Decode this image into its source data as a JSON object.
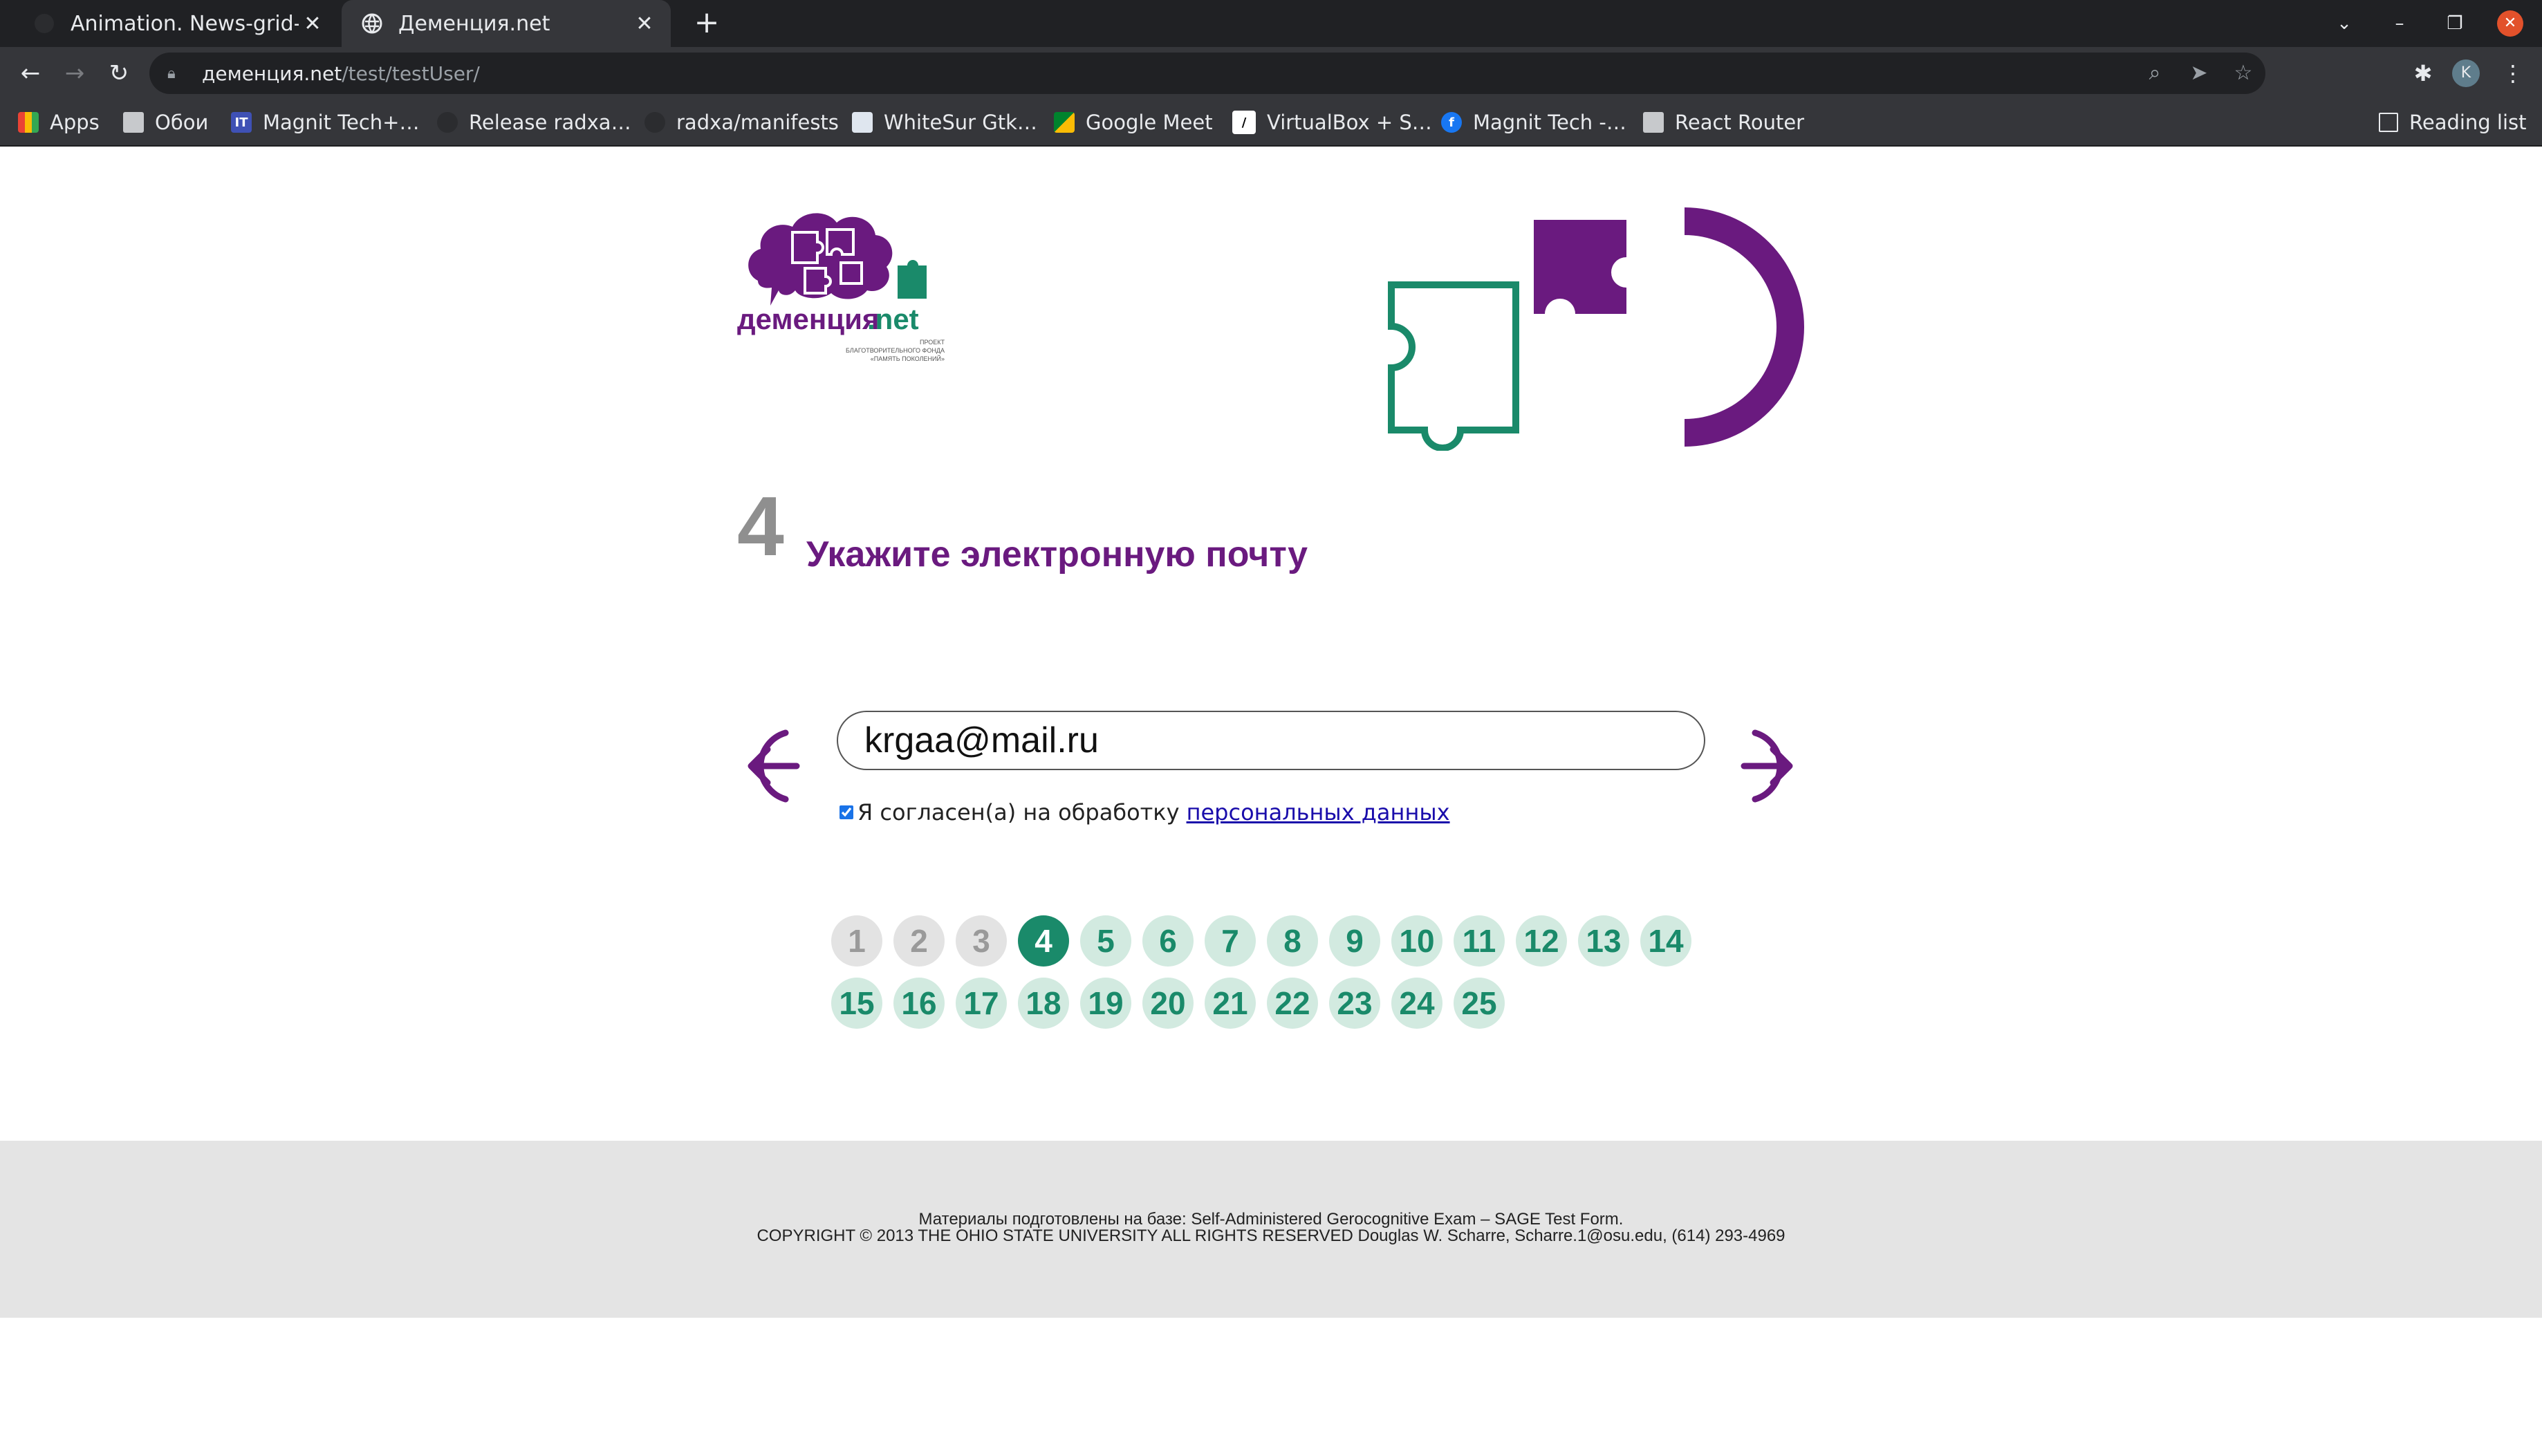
{
  "browser": {
    "tabs": [
      {
        "title": "Animation. News-grid-pag",
        "active": false
      },
      {
        "title": "Деменция.net",
        "active": true
      }
    ],
    "url_host": "деменция.net",
    "url_path": "/test/testUser/",
    "bookmarks": [
      {
        "label": "Apps",
        "icon": "apps-grid-icon"
      },
      {
        "label": "Обои",
        "icon": "folder-icon"
      },
      {
        "label": "Magnit Tech+…",
        "icon": "it-icon"
      },
      {
        "label": "Release radxa…",
        "icon": "github-icon"
      },
      {
        "label": "radxa/manifests",
        "icon": "github-icon"
      },
      {
        "label": "WhiteSur Gtk…",
        "icon": "site-icon"
      },
      {
        "label": "Google Meet",
        "icon": "meet-icon"
      },
      {
        "label": "VirtualBox + S…",
        "icon": "site-icon"
      },
      {
        "label": "Magnit Tech -…",
        "icon": "facebook-icon"
      },
      {
        "label": "React Router",
        "icon": "folder-icon"
      }
    ],
    "reading_list": "Reading list",
    "avatar_letter": "K"
  },
  "logo": {
    "brand": "деменция",
    "brand_suffix": ".net",
    "tagline_1": "ПРОЕКТ",
    "tagline_2": "БЛАГОТВОРИТЕЛЬНОГО ФОНДА",
    "tagline_3": "«ПАМЯТЬ ПОКОЛЕНИЙ»"
  },
  "question": {
    "number": "4",
    "title": "Укажите электронную почту"
  },
  "form": {
    "email_value": "krgaa@mail.ru",
    "consent_checked": true,
    "consent_text": "Я согласен(а) на обработку",
    "consent_link": "персональных данных"
  },
  "pager": {
    "current": 4,
    "pages": [
      "1",
      "2",
      "3",
      "4",
      "5",
      "6",
      "7",
      "8",
      "9",
      "10",
      "11",
      "12",
      "13",
      "14",
      "15",
      "16",
      "17",
      "18",
      "19",
      "20",
      "21",
      "22",
      "23",
      "24",
      "25"
    ]
  },
  "footer": {
    "line1": "Материалы подготовлены на базе: Self-Administered Gerocognitive Exam – SAGE Test Form.",
    "line2": "COPYRIGHT © 2013 THE OHIO STATE UNIVERSITY ALL RIGHTS RESERVED Douglas W. Scharre, Scharre.1@osu.edu, (614) 293-4969"
  },
  "colors": {
    "brand_purple": "#6a1a7f",
    "brand_green": "#1a8a6a",
    "page_done": "#e3e3e3",
    "page_todo": "#d2eae0"
  }
}
